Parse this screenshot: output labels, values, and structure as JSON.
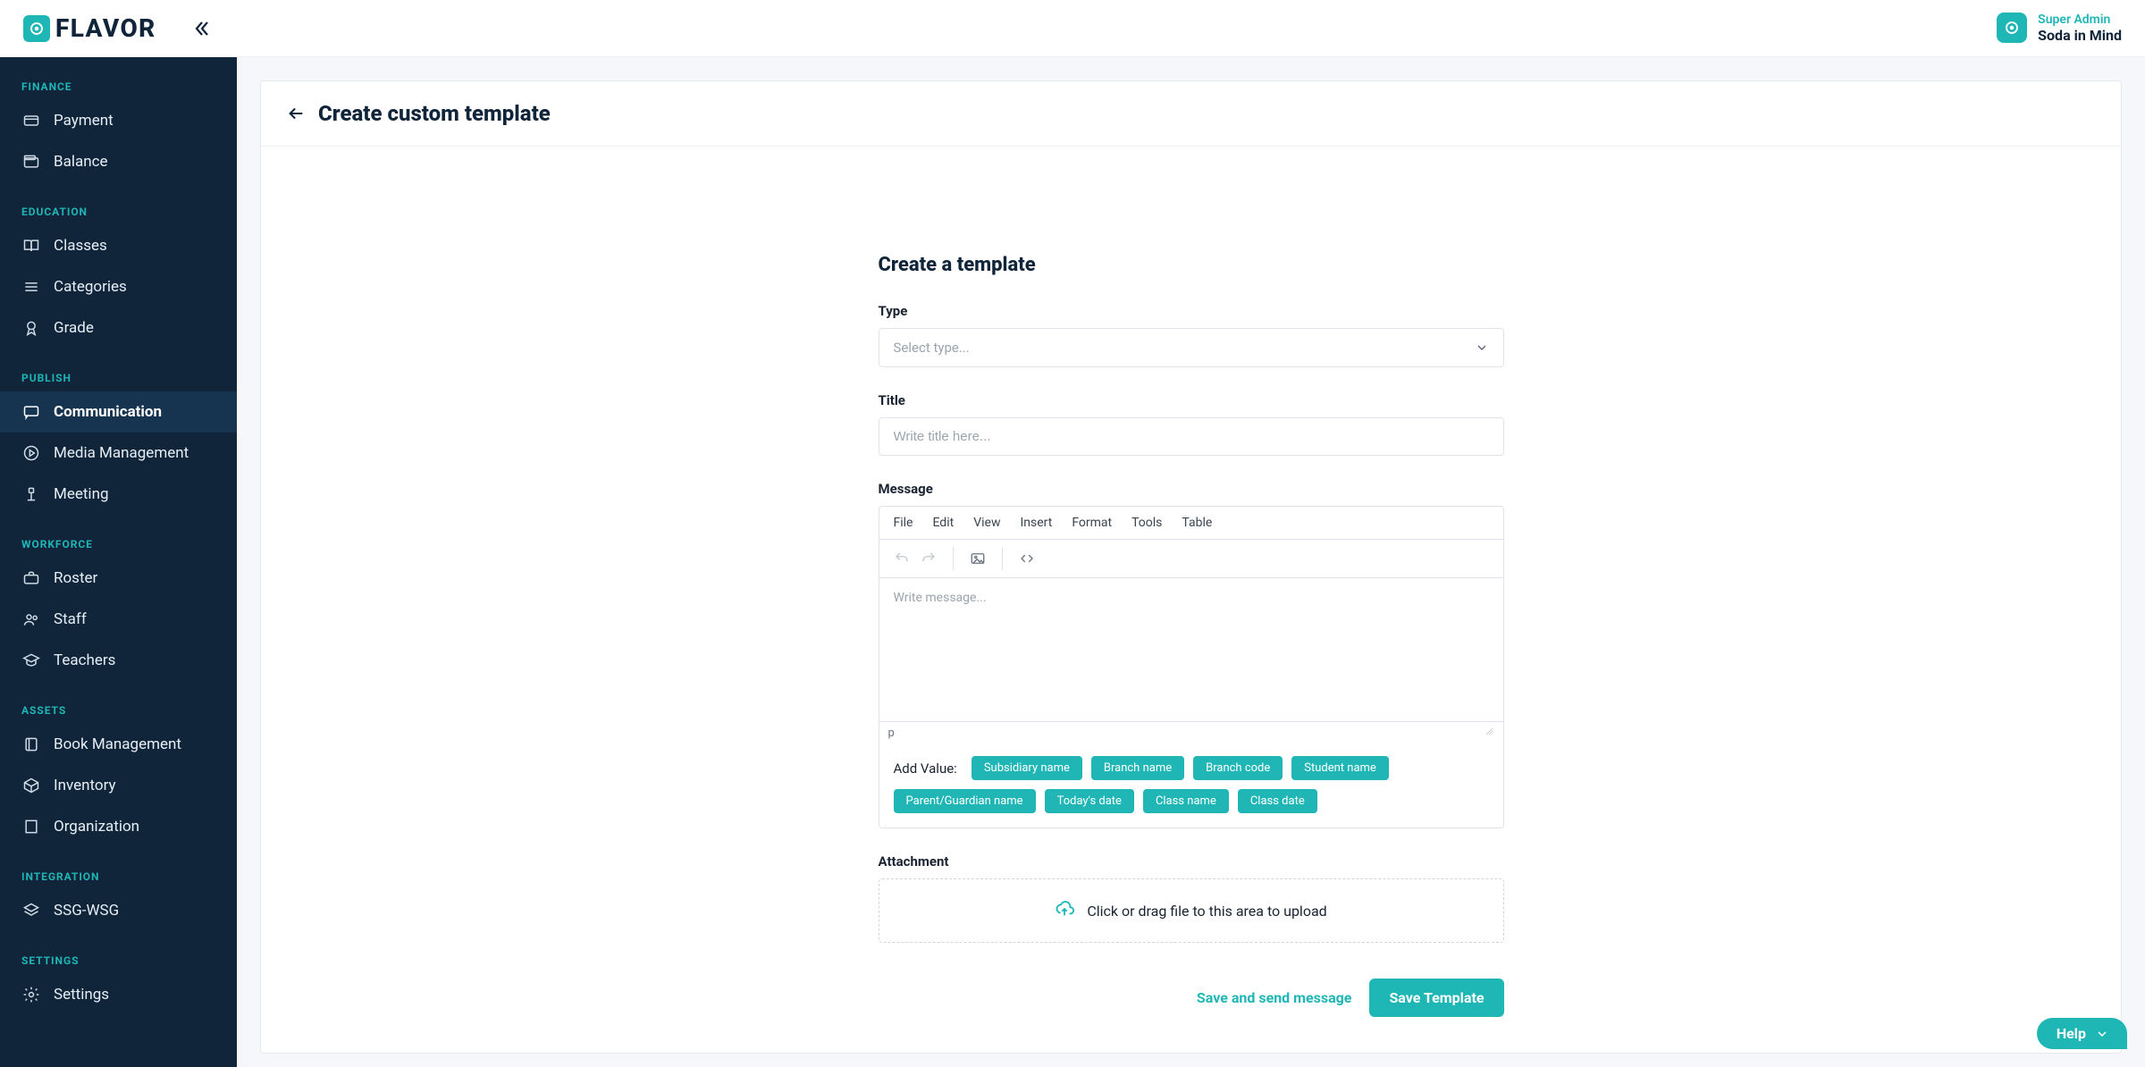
{
  "brand": {
    "name": "FLAVOR"
  },
  "user": {
    "role": "Super Admin",
    "name": "Soda in Mind"
  },
  "sidebar": {
    "sections": [
      {
        "label": "FINANCE",
        "items": [
          {
            "key": "payment",
            "label": "Payment",
            "icon": "credit-card-icon"
          },
          {
            "key": "balance",
            "label": "Balance",
            "icon": "wallet-icon"
          }
        ]
      },
      {
        "label": "EDUCATION",
        "items": [
          {
            "key": "classes",
            "label": "Classes",
            "icon": "book-open-icon"
          },
          {
            "key": "categories",
            "label": "Categories",
            "icon": "menu-icon"
          },
          {
            "key": "grade",
            "label": "Grade",
            "icon": "award-icon"
          }
        ]
      },
      {
        "label": "PUBLISH",
        "items": [
          {
            "key": "communication",
            "label": "Communication",
            "icon": "comment-icon",
            "active": true
          },
          {
            "key": "media",
            "label": "Media Management",
            "icon": "video-icon"
          },
          {
            "key": "meeting",
            "label": "Meeting",
            "icon": "podium-icon"
          }
        ]
      },
      {
        "label": "WORKFORCE",
        "items": [
          {
            "key": "roster",
            "label": "Roster",
            "icon": "briefcase-icon"
          },
          {
            "key": "staff",
            "label": "Staff",
            "icon": "users-icon"
          },
          {
            "key": "teachers",
            "label": "Teachers",
            "icon": "graduation-icon"
          }
        ]
      },
      {
        "label": "ASSETS",
        "items": [
          {
            "key": "bookmgmt",
            "label": "Book Management",
            "icon": "book-icon"
          },
          {
            "key": "inventory",
            "label": "Inventory",
            "icon": "box-icon"
          },
          {
            "key": "organization",
            "label": "Organization",
            "icon": "building-icon"
          }
        ]
      },
      {
        "label": "INTEGRATION",
        "items": [
          {
            "key": "ssgwsg",
            "label": "SSG-WSG",
            "icon": "layers-icon"
          }
        ]
      },
      {
        "label": "SETTINGS",
        "items": [
          {
            "key": "settings",
            "label": "Settings",
            "icon": "gear-icon"
          }
        ]
      }
    ]
  },
  "page": {
    "title": "Create custom template",
    "form_heading": "Create a template",
    "fields": {
      "type": {
        "label": "Type",
        "placeholder": "Select type..."
      },
      "title": {
        "label": "Title",
        "placeholder": "Write title here..."
      },
      "message": {
        "label": "Message",
        "placeholder": "Write message...",
        "path_indicator": "p"
      },
      "attachment": {
        "label": "Attachment",
        "hint": "Click or drag file to this area to upload"
      }
    },
    "editor": {
      "menus": [
        "File",
        "Edit",
        "View",
        "Insert",
        "Format",
        "Tools",
        "Table"
      ]
    },
    "add_value": {
      "label": "Add Value:",
      "chips": [
        "Subsidiary name",
        "Branch name",
        "Branch code",
        "Student name",
        "Parent/Guardian name",
        "Today's date",
        "Class name",
        "Class date"
      ]
    },
    "actions": {
      "secondary": "Save and send message",
      "primary": "Save Template"
    }
  },
  "help": {
    "label": "Help"
  }
}
